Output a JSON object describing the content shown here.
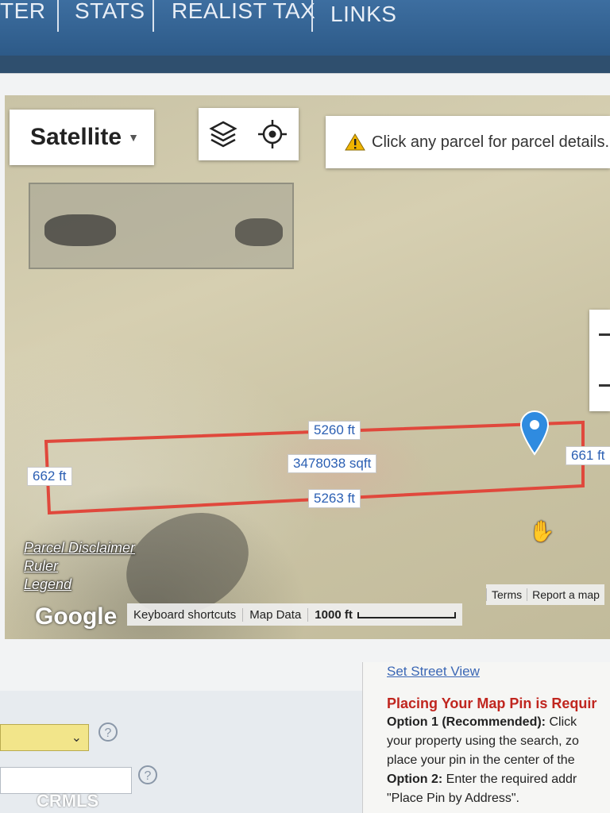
{
  "nav": {
    "items": [
      "TER",
      "STATS",
      "REALIST TAX",
      "LINKS"
    ]
  },
  "map": {
    "map_type_label": "Satellite",
    "info_message": "Click any parcel for parcel details.",
    "parcel": {
      "top_length": "5260 ft",
      "bottom_length": "5263 ft",
      "left_length": "662 ft",
      "right_length": "661 ft",
      "area": "3478038 sqft"
    },
    "links": {
      "parcel_disclaimer": "Parcel Disclaimer",
      "ruler": "Ruler",
      "legend": "Legend"
    },
    "attribution": {
      "logo": "Google",
      "keyboard_shortcuts": "Keyboard shortcuts",
      "map_data": "Map Data",
      "scale": "1000 ft",
      "terms": "Terms",
      "report": "Report a map"
    },
    "icons": {
      "layers": "layers-icon",
      "locate": "crosshair-icon",
      "warning": "warning-icon",
      "pin": "map-pin-icon",
      "cursor": "hand-cursor-icon"
    },
    "colors": {
      "parcel_outline": "#e0483c",
      "pin": "#2f8be0",
      "warning": "#f0b400"
    }
  },
  "panel": {
    "street_view_link": "Set Street View",
    "heading": "Placing Your Map Pin is Requir",
    "option1_label": "Option 1 (Recommended):",
    "option1_line1_rest": " Click",
    "option1_line2": "your property using the search, zo",
    "option1_line3": "place your pin in the center of the",
    "option2_label": "Option 2:",
    "option2_rest": " Enter the required addr",
    "option2_line2": "\"Place Pin by Address\"."
  },
  "form": {
    "help_symbol": "?"
  },
  "watermark": "CRMLS"
}
